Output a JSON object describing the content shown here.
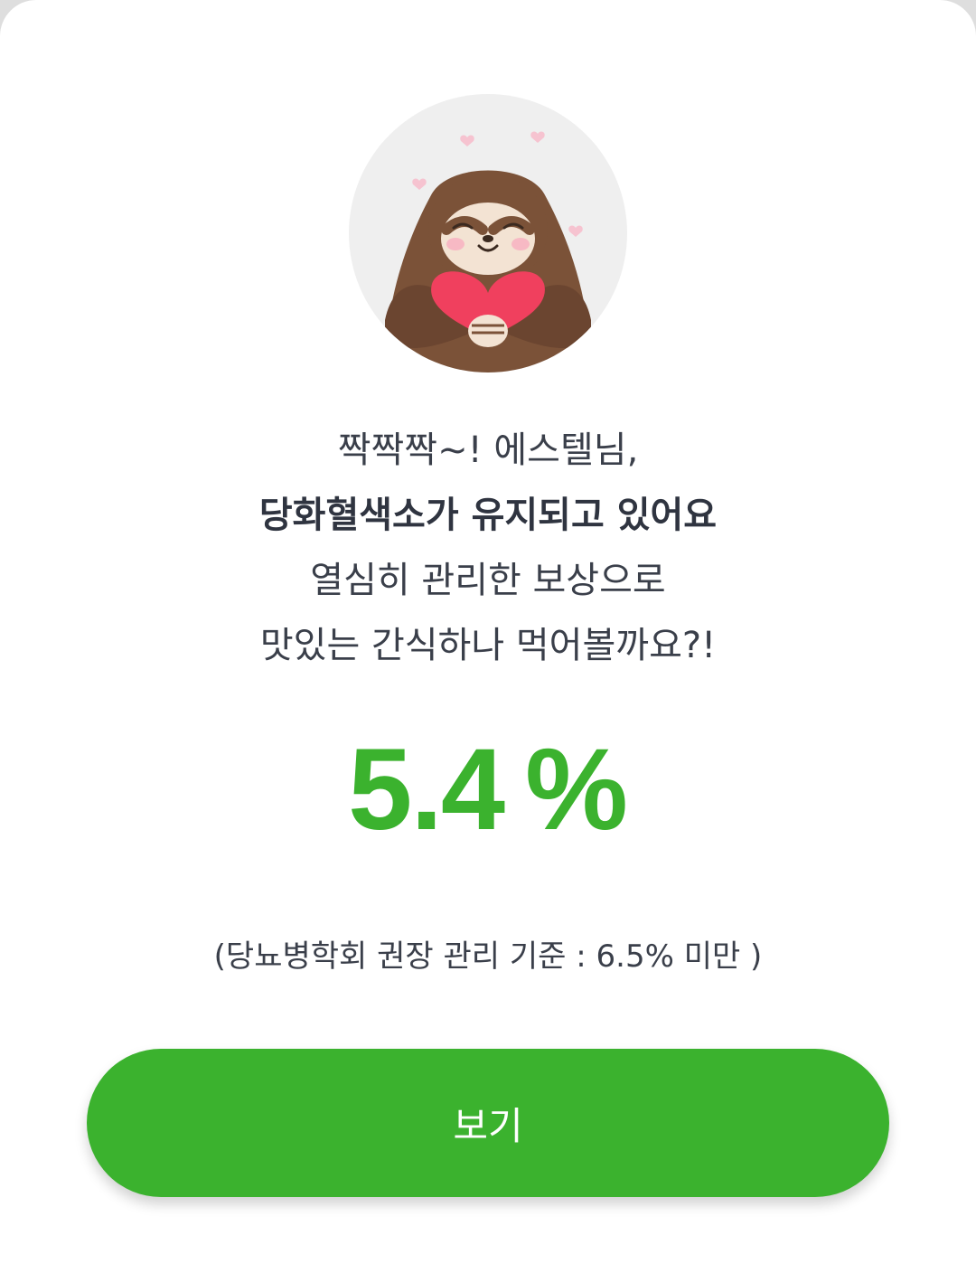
{
  "illustration": {
    "icon": "sloth-hugging-heart-icon"
  },
  "message": {
    "line1": "짝짝짝~! 에스텔님,",
    "line2": "당화혈색소가 유지되고 있어요",
    "line3": "열심히 관리한 보상으로",
    "line4": "맛있는 간식하나 먹어볼까요?!"
  },
  "result": {
    "value": "5.4",
    "unit": "%"
  },
  "reference_note": "(당뇨병학회 권장 관리 기준 : 6.5% 미만 )",
  "action": {
    "view_label": "보기"
  },
  "colors": {
    "accent": "#3bb22e",
    "text": "#3a3f4a",
    "avatar_background": "#efefef",
    "card_background": "#ffffff"
  }
}
